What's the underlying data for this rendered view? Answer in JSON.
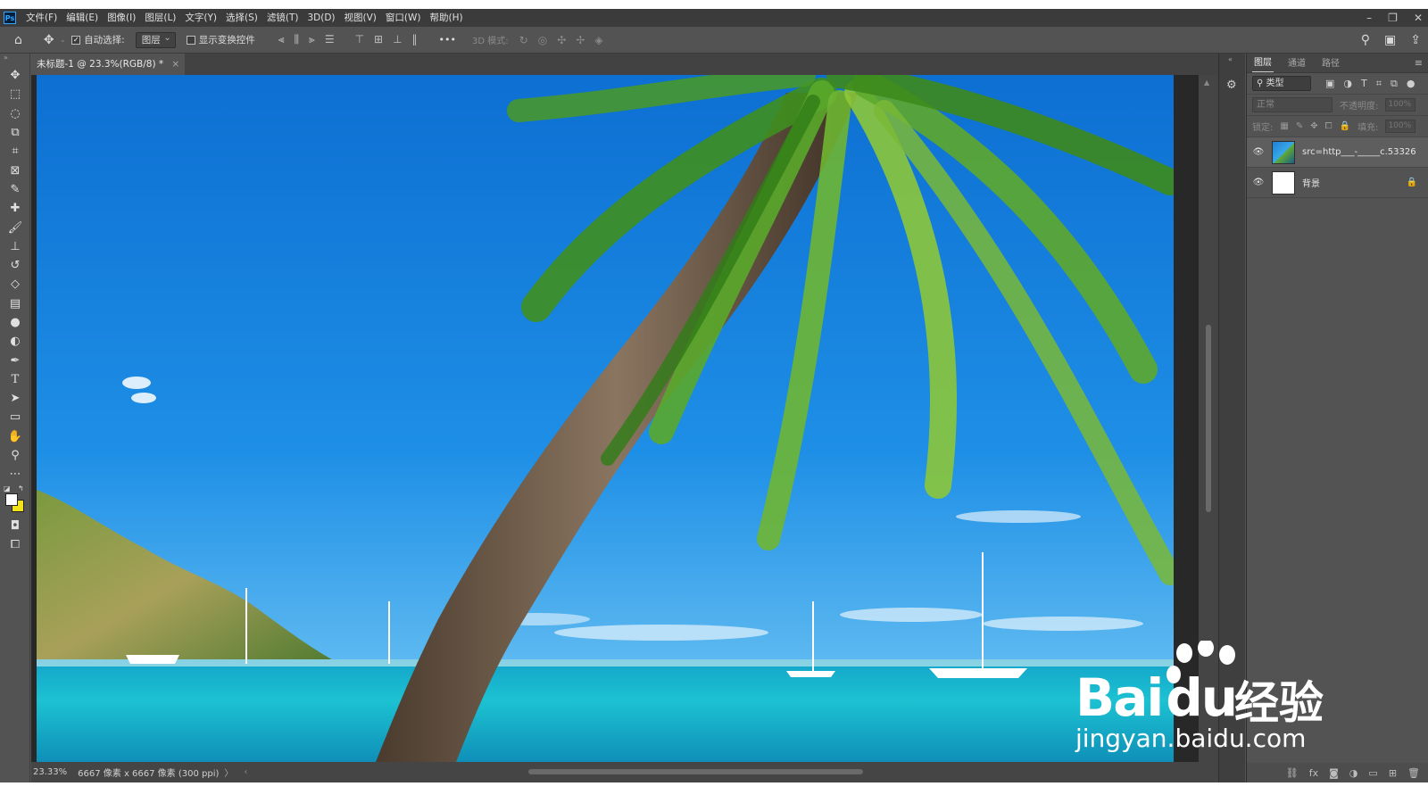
{
  "app": {
    "logo": "Ps",
    "menu": [
      "文件(F)",
      "编辑(E)",
      "图像(I)",
      "图层(L)",
      "文字(Y)",
      "选择(S)",
      "滤镜(T)",
      "3D(D)",
      "视图(V)",
      "窗口(W)",
      "帮助(H)"
    ]
  },
  "options": {
    "auto_select_label": "自动选择:",
    "auto_select_checked": "✓",
    "target_value": "图层",
    "show_transform_label": "显示变换控件",
    "more_label": "•••",
    "mode_3d_label": "3D 模式:"
  },
  "document": {
    "tab_title": "未标题-1 @ 23.3%(RGB/8) *",
    "close_glyph": "×"
  },
  "status": {
    "zoom": "23.33%",
    "dimensions": "6667 像素 x 6667 像素 (300 ppi)",
    "arrow": "〉",
    "left_arrow": "‹"
  },
  "layers_panel": {
    "tabs": [
      "图层",
      "通道",
      "路径"
    ],
    "filter_label": "类型",
    "blend_mode": "正常",
    "opacity_label": "不透明度:",
    "opacity_value": "100%",
    "lock_label": "锁定:",
    "fill_label": "填充:",
    "fill_value": "100%",
    "layers": [
      {
        "name": "src=http___-_____c.53326",
        "thumb": "photo"
      },
      {
        "name": "背景",
        "thumb": "white",
        "locked": true
      }
    ]
  },
  "colors": {
    "foreground": "#ffffff",
    "background": "#f3e21a"
  },
  "watermark": {
    "brand_latin": "Bai",
    "brand_du": "du",
    "brand_cn": "经验",
    "url": "jingyan.baidu.com"
  }
}
